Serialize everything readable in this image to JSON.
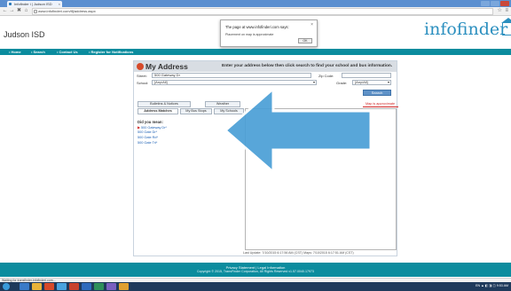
{
  "browser": {
    "tab_label": "Infofinder i | Judson ISD",
    "tab_close": "×",
    "window_title": "",
    "back": "←",
    "forward": "→",
    "stop": "✖",
    "home": "⌂",
    "url": "www.infofinderi.com/tfj/address.aspx",
    "right_icons": "☆ ≡"
  },
  "site": {
    "title": "Judson ISD",
    "logo_text": "infofinder",
    "logo_i": "i",
    "menu": [
      {
        "label": "• Home"
      },
      {
        "label": "• Search"
      },
      {
        "label": "• Contact Us"
      },
      {
        "label": "• Register for Notifications"
      }
    ]
  },
  "dialog": {
    "title": "The page at www.infofinderi.com says:",
    "message": "Placement on map is approximate",
    "close": "×",
    "ok": "OK"
  },
  "panel": {
    "title": "My Address",
    "subtitle": "Enter your address below then click search to find your school and bus information.",
    "street_label": "Street:",
    "street_value": "500 Gateway Dr",
    "zip_label": "Zip Code:",
    "zip_value": "",
    "school_label": "School:",
    "school_value": "[Any/All]",
    "grade_label": "Grade:",
    "grade_value": "[Any/All]",
    "caret": "▾",
    "search_button": "Search",
    "tabs_top": [
      {
        "label": "Bulletins & Notices"
      },
      {
        "label": "Weather"
      }
    ],
    "tabs_bottom": [
      {
        "label": "Address Matches"
      },
      {
        "label": "My Bus Stops"
      },
      {
        "label": "My Schools"
      }
    ],
    "map_note": "Map is approximate",
    "results_heading": "Did you mean:",
    "results": [
      "500 Gateway Dr*",
      "500 Gate Dr*",
      "500 Gate Rd*",
      "500 Gate Trl*"
    ],
    "last_update": "Last Update: 7/10/2015 6:17:56 AM (CST) Maps: 7/10/2015 6:17:51 AM (CST)"
  },
  "footer": {
    "links": "Privacy Statement | Legal Information",
    "copyright": "Copyright © 2015, TransFinder Corporation, All Rights Reserved v1.57.0040.17973"
  },
  "status": {
    "text": "Waiting for transfinder.infofinderi.com..."
  },
  "taskbar": {
    "tray_text": "EN ▲ ◧ ◨ ◫ 9:53 AM"
  },
  "colors": {
    "accent_teal": "#0b8c9e",
    "logo_blue": "#2b8fbf",
    "arrow_blue": "#4a9fd6",
    "arrow_border": "#ffffff",
    "alert_red": "#d12b2b"
  }
}
